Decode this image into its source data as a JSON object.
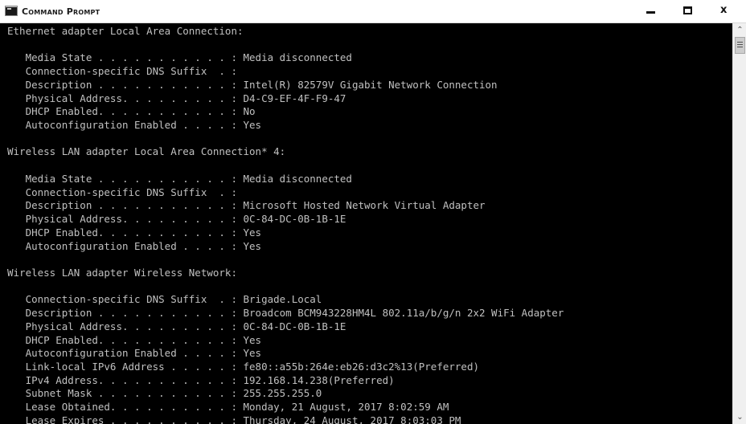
{
  "window": {
    "title": "Command Prompt",
    "controls": {
      "minimize_icon": "minimize-icon",
      "maximize_icon": "maximize-icon",
      "close_glyph": "x"
    }
  },
  "console": {
    "text_color": "#c0c0c0",
    "background_color": "#000000",
    "lines": [
      "Ethernet adapter Local Area Connection:",
      "",
      "   Media State . . . . . . . . . . . : Media disconnected",
      "   Connection-specific DNS Suffix  . :",
      "   Description . . . . . . . . . . . : Intel(R) 82579V Gigabit Network Connection",
      "   Physical Address. . . . . . . . . : D4-C9-EF-4F-F9-47",
      "   DHCP Enabled. . . . . . . . . . . : No",
      "   Autoconfiguration Enabled . . . . : Yes",
      "",
      "Wireless LAN adapter Local Area Connection* 4:",
      "",
      "   Media State . . . . . . . . . . . : Media disconnected",
      "   Connection-specific DNS Suffix  . :",
      "   Description . . . . . . . . . . . : Microsoft Hosted Network Virtual Adapter",
      "   Physical Address. . . . . . . . . : 0C-84-DC-0B-1B-1E",
      "   DHCP Enabled. . . . . . . . . . . : Yes",
      "   Autoconfiguration Enabled . . . . : Yes",
      "",
      "Wireless LAN adapter Wireless Network:",
      "",
      "   Connection-specific DNS Suffix  . : Brigade.Local",
      "   Description . . . . . . . . . . . : Broadcom BCM943228HM4L 802.11a/b/g/n 2x2 WiFi Adapter",
      "   Physical Address. . . . . . . . . : 0C-84-DC-0B-1B-1E",
      "   DHCP Enabled. . . . . . . . . . . : Yes",
      "   Autoconfiguration Enabled . . . . : Yes",
      "   Link-local IPv6 Address . . . . . : fe80::a55b:264e:eb26:d3c2%13(Preferred)",
      "   IPv4 Address. . . . . . . . . . . : 192.168.14.238(Preferred)",
      "   Subnet Mask . . . . . . . . . . . : 255.255.255.0",
      "   Lease Obtained. . . . . . . . . . : Monday, 21 August, 2017 8:02:59 AM",
      "   Lease Expires . . . . . . . . . . : Thursday, 24 August, 2017 8:03:03 PM"
    ]
  },
  "scrollbar": {
    "up_icon": "chevron-up-icon",
    "down_icon": "chevron-down-icon",
    "grip_icon": "thumb-grip-icon"
  }
}
